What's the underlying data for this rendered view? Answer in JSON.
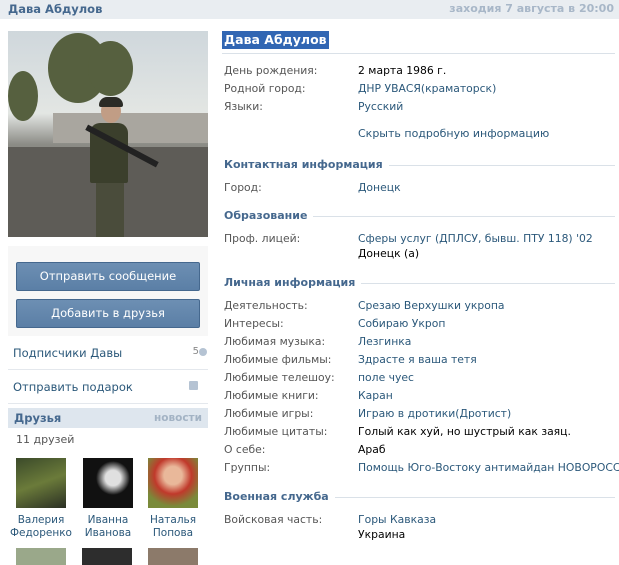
{
  "header": {
    "name": "Дава Абдулов",
    "last_seen": "заходия 7 августа в 20:00"
  },
  "actions": {
    "send_message": "Отправить сообщение",
    "add_friend": "Добавить в друзья"
  },
  "sidebar": {
    "subscribers_label": "Подписчики Давы",
    "subscribers_count": "5",
    "gift_label": "Отправить подарок"
  },
  "friends": {
    "title": "Друзья",
    "news_link": "новости",
    "count_text": "11 друзей",
    "items": [
      {
        "first": "Валерия",
        "last": "Федоренко"
      },
      {
        "first": "Иванна",
        "last": "Иванова"
      },
      {
        "first": "Наталья",
        "last": "Попова"
      }
    ]
  },
  "profile": {
    "name": "Дава Абдулов",
    "basic": [
      {
        "key": "День рождения:",
        "value": "2 марта 1986 г."
      },
      {
        "key": "Родной город:",
        "value": "ДНР УВАСЯ(краматорск)"
      },
      {
        "key": "Языки:",
        "value": "Русский"
      }
    ],
    "toggle": "Скрыть подробную информацию",
    "contacts_title": "Контактная информация",
    "contacts": [
      {
        "key": "Город:",
        "value": "Донецк"
      }
    ],
    "education_title": "Образование",
    "education": [
      {
        "key": "Проф. лицей:",
        "value": "Сферы услуг (ДПЛСУ, бывш. ПТУ 118) '02",
        "value2": "Донецк (а)"
      }
    ],
    "personal_title": "Личная информация",
    "personal": [
      {
        "key": "Деятельность:",
        "value": "Срезаю Верхушки укропа"
      },
      {
        "key": "Интересы:",
        "value": "Собираю Укроп"
      },
      {
        "key": "Любимая музыка:",
        "value": "Лезгинка"
      },
      {
        "key": "Любимые фильмы:",
        "value": "Здрасте я ваша тетя"
      },
      {
        "key": "Любимые телешоу:",
        "value": "поле чуес"
      },
      {
        "key": "Любимые книги:",
        "value": "Каран"
      },
      {
        "key": "Любимые игры:",
        "value": "Играю в дротики(Дротист)"
      },
      {
        "key": "Любимые цитаты:",
        "value": "Голый как хуй, но шустрый как заяц."
      },
      {
        "key": "О себе:",
        "value": "Араб"
      },
      {
        "key": "Группы:",
        "value": "Помощь Юго-Востоку антимайдан НОВОРОССИЯ"
      }
    ],
    "military_title": "Военная служба",
    "military": [
      {
        "key": "Войсковая часть:",
        "value": "Горы Кавказа",
        "value2": "Украина"
      }
    ]
  },
  "colors": {
    "accent": "#45688e",
    "link": "#2b587a",
    "button": "#5b7fa6",
    "highlight": "#3166b3"
  },
  "icons": {
    "subscribers": "people-icon",
    "gift": "gift-icon"
  }
}
